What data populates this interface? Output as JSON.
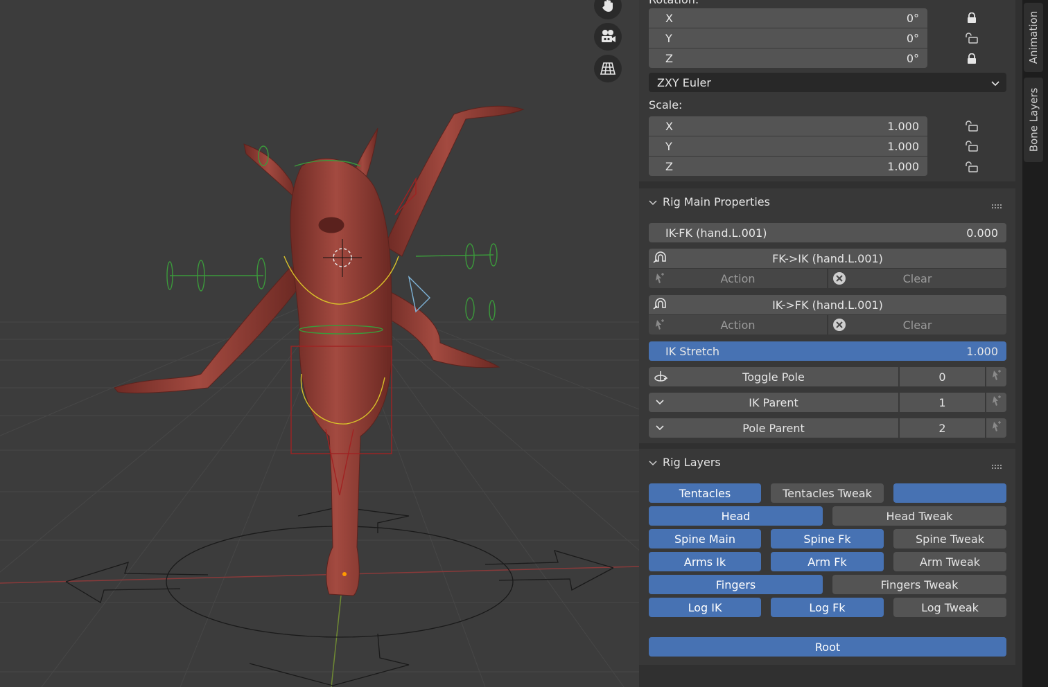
{
  "transform": {
    "rotation_label": "Rotation:",
    "rotation": [
      {
        "axis": "X",
        "value": "0°",
        "lock": "locked"
      },
      {
        "axis": "Y",
        "value": "0°",
        "lock": "unlocked"
      },
      {
        "axis": "Z",
        "value": "0°",
        "lock": "locked"
      }
    ],
    "rotation_mode": "ZXY Euler",
    "scale_label": "Scale:",
    "scale": [
      {
        "axis": "X",
        "value": "1.000",
        "lock": "unlocked"
      },
      {
        "axis": "Y",
        "value": "1.000",
        "lock": "unlocked"
      },
      {
        "axis": "Z",
        "value": "1.000",
        "lock": "unlocked"
      }
    ]
  },
  "rig_main": {
    "title": "Rig Main Properties",
    "ikfk_label": "IK-FK (hand.L.001)",
    "ikfk_value": "0.000",
    "fk_to_ik": "FK->IK (hand.L.001)",
    "ik_to_fk": "IK->FK (hand.L.001)",
    "action_label": "Action",
    "clear_label": "Clear",
    "ik_stretch_label": "IK Stretch",
    "ik_stretch_value": "1.000",
    "ik_stretch_fraction": 1.0,
    "toggle_pole_label": "Toggle Pole",
    "toggle_pole_value": "0",
    "ik_parent_label": "IK Parent",
    "ik_parent_value": "1",
    "pole_parent_label": "Pole Parent",
    "pole_parent_value": "2"
  },
  "rig_layers": {
    "title": "Rig Layers",
    "buttons": {
      "tentacles": "Tentacles",
      "tentacles_tweak": "Tentacles Tweak",
      "blank": "",
      "head": "Head",
      "head_tweak": "Head Tweak",
      "spine_main": "Spine Main",
      "spine_fk": "Spine Fk",
      "spine_tweak": "Spine Tweak",
      "arms_ik": "Arms Ik",
      "arm_fk": "Arm Fk",
      "arm_tweak": "Arm Tweak",
      "fingers": "Fingers",
      "fingers_tweak": "Fingers Tweak",
      "log_ik": "Log IK",
      "log_fk": "Log Fk",
      "log_tweak": "Log Tweak",
      "root": "Root"
    }
  },
  "side_tabs": [
    "Animation",
    "Bone Layers"
  ],
  "viewport": {
    "nav_icons": [
      "hand-pan-icon",
      "camera-icon",
      "grid-perspective-icon"
    ]
  },
  "colors": {
    "accent_blue": "#4772b3",
    "field_gray": "#545454",
    "panel_bg": "#303030",
    "mesh": "#8f3b33"
  }
}
